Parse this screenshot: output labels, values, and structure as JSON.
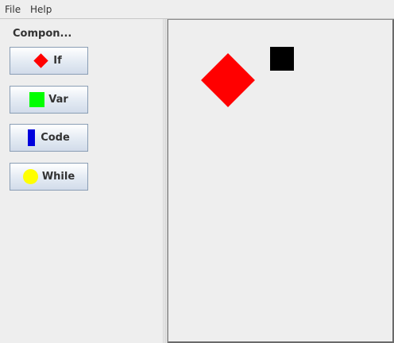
{
  "menubar": {
    "items": [
      {
        "label": "File"
      },
      {
        "label": "Help"
      }
    ]
  },
  "components_panel": {
    "title": "Compon...",
    "buttons": [
      {
        "label": "If",
        "icon": "red-diamond-icon"
      },
      {
        "label": "Var",
        "icon": "green-square-icon"
      },
      {
        "label": "Code",
        "icon": "blue-rectangle-icon"
      },
      {
        "label": "While",
        "icon": "yellow-circle-icon"
      }
    ]
  },
  "canvas": {
    "shapes": [
      {
        "type": "diamond",
        "color": "#ff0000"
      },
      {
        "type": "square",
        "color": "#000000"
      }
    ]
  },
  "colors": {
    "if": "#ff0000",
    "var": "#00ff00",
    "code": "#0000dd",
    "while": "#ffff00",
    "button_border": "#8a9eb5"
  }
}
